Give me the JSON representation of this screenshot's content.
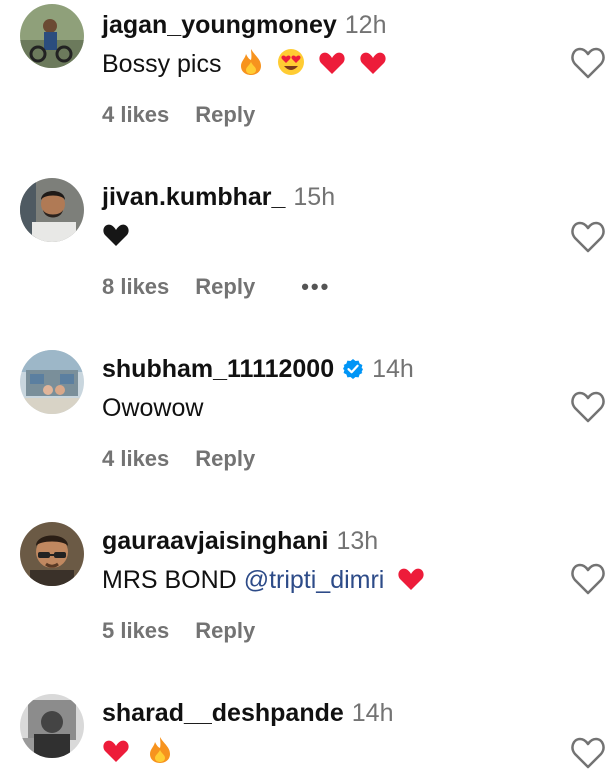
{
  "comments": [
    {
      "username": "jagan_youngmoney",
      "time": "12h",
      "text": "Bossy pics",
      "emojis": [
        "fire-emoji",
        "heart-eyes-emoji",
        "red-heart-emoji",
        "red-heart-emoji"
      ],
      "likes": "4 likes",
      "reply": "Reply"
    },
    {
      "username": "jivan.kumbhar_",
      "time": "15h",
      "text": "",
      "emojis": [
        "black-heart-emoji"
      ],
      "likes": "8 likes",
      "reply": "Reply",
      "more": "•••"
    },
    {
      "username": "shubham_11112000",
      "verified": true,
      "time": "14h",
      "text": "Owowow",
      "likes": "4 likes",
      "reply": "Reply"
    },
    {
      "username": "gauraavjaisinghani",
      "time": "13h",
      "text": "MRS BOND",
      "mention": "@tripti_dimri",
      "emojis": [
        "red-heart-emoji"
      ],
      "likes": "5 likes",
      "reply": "Reply"
    },
    {
      "username": "sharad__deshpande",
      "time": "14h",
      "text": "",
      "emojis": [
        "red-heart-emoji",
        "fire-emoji"
      ]
    }
  ],
  "colors": {
    "text": "#111111",
    "secondary": "#737373",
    "mention": "#2d4b88",
    "verified": "#0095f6",
    "heart": "#ed1c3a"
  }
}
